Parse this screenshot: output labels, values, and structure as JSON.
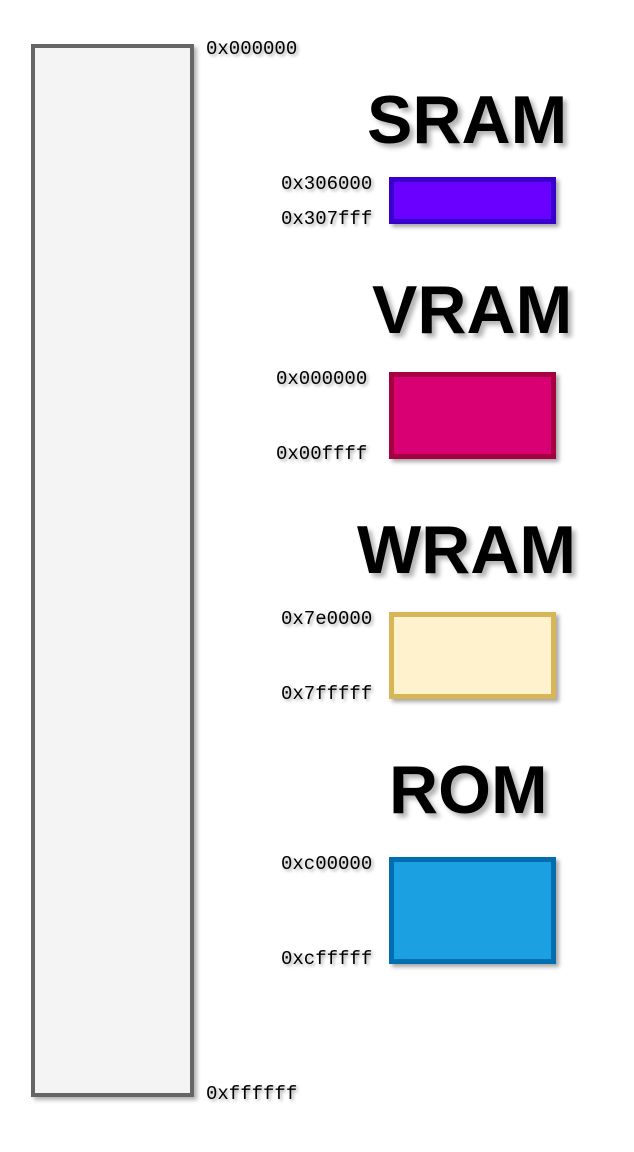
{
  "address_space": {
    "start_label": "0x000000",
    "end_label": "0xffffff"
  },
  "regions": [
    {
      "name": "SRAM",
      "start": "0x306000",
      "end": "0x307fff",
      "fill": "#6a00ff",
      "stroke": "#3700cc"
    },
    {
      "name": "VRAM",
      "start": "0x000000",
      "end": "0x00ffff",
      "fill": "#d80073",
      "stroke": "#a50040"
    },
    {
      "name": "WRAM",
      "start": "0x7e0000",
      "end": "0x7fffff",
      "fill": "#fff2cc",
      "stroke": "#d6b656"
    },
    {
      "name": "ROM",
      "start": "0xc00000",
      "end": "0xcfffff",
      "fill": "#1ba1e2",
      "stroke": "#006eaf"
    }
  ]
}
